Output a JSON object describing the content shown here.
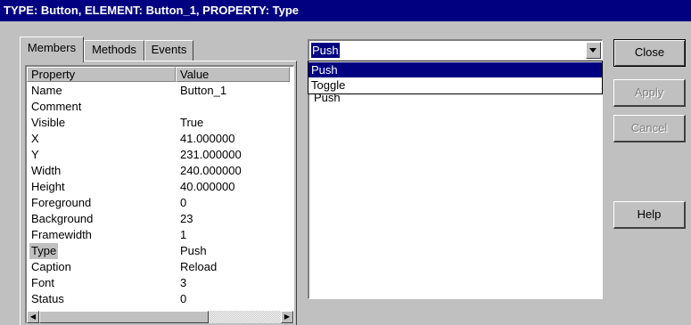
{
  "window": {
    "title": "TYPE: Button,  ELEMENT: Button_1,  PROPERTY: Type"
  },
  "tabs": [
    {
      "label": "Members",
      "active": true
    },
    {
      "label": "Methods",
      "active": false
    },
    {
      "label": "Events",
      "active": false
    }
  ],
  "grid": {
    "headers": {
      "property": "Property",
      "value": "Value"
    },
    "rows": [
      {
        "property": "Name",
        "value": "Button_1"
      },
      {
        "property": "Comment",
        "value": ""
      },
      {
        "property": "Visible",
        "value": "True"
      },
      {
        "property": "X",
        "value": "41.000000"
      },
      {
        "property": "Y",
        "value": "231.000000"
      },
      {
        "property": "Width",
        "value": "240.000000"
      },
      {
        "property": "Height",
        "value": "40.000000"
      },
      {
        "property": "Foreground",
        "value": "0"
      },
      {
        "property": "Background",
        "value": "23"
      },
      {
        "property": "Framewidth",
        "value": "1"
      },
      {
        "property": "Type",
        "value": "Push"
      },
      {
        "property": "Caption",
        "value": "Reload"
      },
      {
        "property": "Font",
        "value": "3"
      },
      {
        "property": "Status",
        "value": "0"
      }
    ],
    "selected_property": "Type"
  },
  "combo": {
    "selected_value": "Push",
    "options": [
      "Push",
      "Toggle"
    ],
    "highlighted_option": "Push",
    "background_text": "Push"
  },
  "buttons": {
    "close": "Close",
    "apply": "Apply",
    "cancel": "Cancel",
    "help": "Help"
  }
}
